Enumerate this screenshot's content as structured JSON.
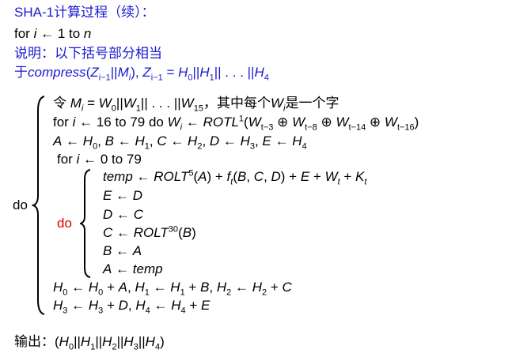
{
  "title": "SHA-1计算过程（续）：",
  "line_for": {
    "kw": "for",
    "var": "i",
    "arrow": "←",
    "rest": "1 to",
    "n": "n"
  },
  "note": "说明：以下括号部分相当",
  "note2": {
    "prefix": "于",
    "func": "compress",
    "z": "Z",
    "sub": "i−1",
    "m": "M",
    "msub": "i",
    "eq": "= H",
    "h0": "0",
    "h1": "1",
    "h4": "4"
  },
  "outer_do": "do",
  "inner_do": "do",
  "body": {
    "l1_prefix": "令",
    "l1_suffix": "，其中每个",
    "l1_end": "是一个字",
    "l2_for": "for",
    "l2_range": "16 to 79 do",
    "l2_fn": "ROTL",
    "l4_for": "for",
    "l4_range": "0 to 79",
    "temp": "temp",
    "rolt": "ROLT"
  },
  "output_label": "输出："
}
